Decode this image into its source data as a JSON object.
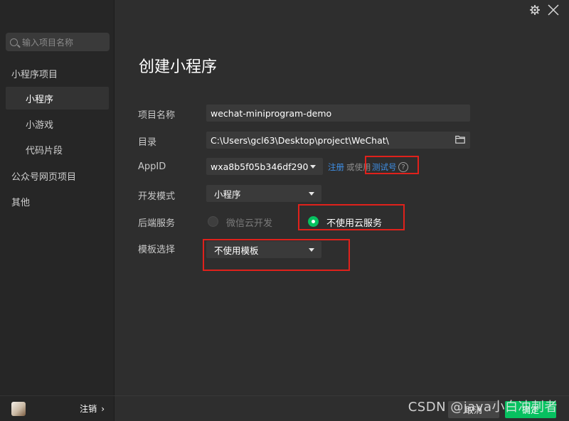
{
  "sidebar": {
    "search_placeholder": "输入项目名称",
    "groups": [
      {
        "label": "小程序项目"
      },
      {
        "label": "公众号网页项目"
      },
      {
        "label": "其他"
      }
    ],
    "items": [
      {
        "label": "小程序",
        "active": true
      },
      {
        "label": "小游戏"
      },
      {
        "label": "代码片段"
      }
    ],
    "logout_label": "注销",
    "logout_chevron": "›"
  },
  "topbar": {
    "gear_icon": "gear-icon",
    "close_icon": "close-icon"
  },
  "form": {
    "title": "创建小程序",
    "project_name_label": "项目名称",
    "project_name_value": "wechat-miniprogram-demo",
    "dir_label": "目录",
    "dir_value": "C:\\Users\\gcl63\\Desktop\\project\\WeChat\\",
    "appid_label": "AppID",
    "appid_value": "wxa8b5f05b346df290",
    "register_link": "注册",
    "or_use_text": "或使用",
    "test_account_link": "测试号",
    "help_mark": "?",
    "dev_mode_label": "开发模式",
    "dev_mode_value": "小程序",
    "backend_label": "后端服务",
    "backend_option_cloud": "微信云开发",
    "backend_option_none": "不使用云服务",
    "template_label": "模板选择",
    "template_value": "不使用模板"
  },
  "footer": {
    "cancel_label": "取消",
    "confirm_label": "确定",
    "watermark": "CSDN @java小白冲刺者"
  },
  "colors": {
    "accent_green": "#07c160",
    "link_blue": "#3f8fe6",
    "annotation_red": "#e0211b"
  }
}
